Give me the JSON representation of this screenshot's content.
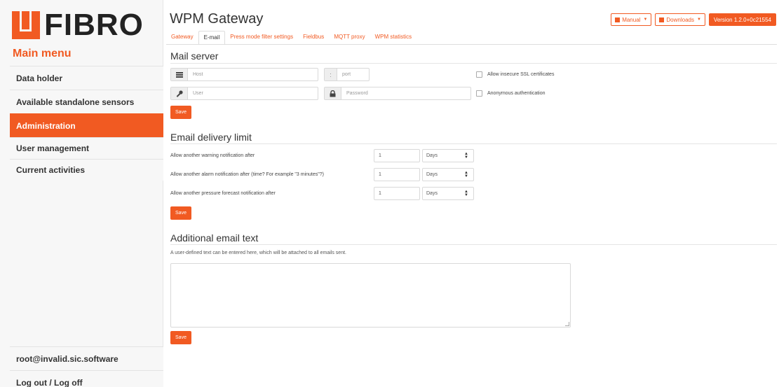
{
  "brand": {
    "logo_text": "FIBRO",
    "accent_color": "#f15a22"
  },
  "sidebar": {
    "title": "Main menu",
    "items": [
      {
        "label": "Data holder"
      },
      {
        "label": "Available standalone sensors"
      },
      {
        "label": "Administration",
        "active": true
      },
      {
        "label": "User management"
      },
      {
        "label": "Current activities"
      }
    ],
    "user": "root@invalid.sic.software",
    "logout": "Log out / Log off"
  },
  "header": {
    "title": "WPM Gateway",
    "manual_label": "Manual",
    "downloads_label": "Downloads",
    "version_label": "Version 1.2.0+0c21554",
    "manual_icon": "book-icon",
    "downloads_icon": "download-icon"
  },
  "tabs": [
    {
      "label": "Gateway"
    },
    {
      "label": "E-mail",
      "active": true
    },
    {
      "label": "Press mode filter settings"
    },
    {
      "label": "Fieldbus"
    },
    {
      "label": "MQTT proxy"
    },
    {
      "label": "WPM statistics"
    }
  ],
  "mail_server": {
    "title": "Mail server",
    "host_placeholder": "Host",
    "port_separator": ":",
    "port_placeholder": "port",
    "user_placeholder": "User",
    "password_placeholder": "Password",
    "allow_insecure_label": "Allow insecure SSL certificates",
    "anonymous_label": "Anonymous authentication",
    "save_label": "Save"
  },
  "delivery_limit": {
    "title": "Email delivery limit",
    "rows": [
      {
        "label": "Allow another warning notification after",
        "value": "1",
        "unit": "Days"
      },
      {
        "label": "Allow another alarm notification after (time? For example \"3 minutes\"?)",
        "value": "1",
        "unit": "Days"
      },
      {
        "label": "Allow another pressure forecast notification after",
        "value": "1",
        "unit": "Days"
      }
    ],
    "save_label": "Save"
  },
  "additional_text": {
    "title": "Additional email text",
    "help": "A user-defined text can be entered here, which will be attached to all emails sent.",
    "value": "",
    "save_label": "Save"
  }
}
